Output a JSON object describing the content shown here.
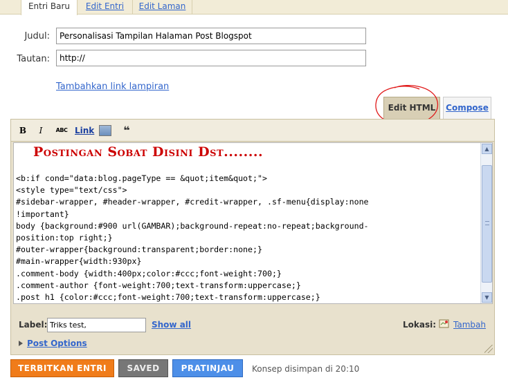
{
  "top_tabs": [
    {
      "label": "Entri Baru",
      "active": true
    },
    {
      "label": "Edit Entri",
      "active": false
    },
    {
      "label": "Edit Laman",
      "active": false
    }
  ],
  "form": {
    "title_label": "Judul:",
    "title_value": "Personalisasi Tampilan Halaman Post Blogspot",
    "link_label": "Tautan:",
    "link_value": "http://",
    "attachment_link": "Tambahkan link lampiran"
  },
  "mode_tabs": {
    "edit_html": "Edit HTML",
    "compose": "Compose"
  },
  "toolbar": {
    "bold": "B",
    "italic": "I",
    "strike": "ABC",
    "link": "Link",
    "quote": "❝"
  },
  "editor": {
    "heading": "Postingan Sobat Disini Dst........",
    "code": "<b:if cond=\"data:blog.pageType == &quot;item&quot;\">\n<style type=\"text/css\">\n#sidebar-wrapper, #header-wrapper, #credit-wrapper, .sf-menu{display:none\n!important}\nbody {background:#900 url(GAMBAR);background-repeat:no-repeat;background-\nposition:top right;}\n#outer-wrapper{background:transparent;border:none;}\n#main-wrapper{width:930px}\n.comment-body {width:400px;color:#ccc;font-weight:700;}\n.comment-author {font-weight:700;text-transform:uppercase;}\n.post h1 {color:#ccc;font-weight:700;text-transform:uppercase;}\n</style>"
  },
  "labels": {
    "caption": "Label:",
    "value": "Triks test,",
    "show_all": "Show all",
    "location_caption": "Lokasi:",
    "add_location": "Tambah"
  },
  "post_options": "Post Options",
  "actions": {
    "publish": "TERBITKAN ENTRI",
    "saved": "SAVED",
    "preview": "PRATINJAU",
    "status": "Konsep disimpan di 20:10"
  },
  "colors": {
    "publish": "#f07c1a",
    "preview": "#4d8fe8",
    "heading": "#cc0000",
    "link": "#3366cc"
  }
}
